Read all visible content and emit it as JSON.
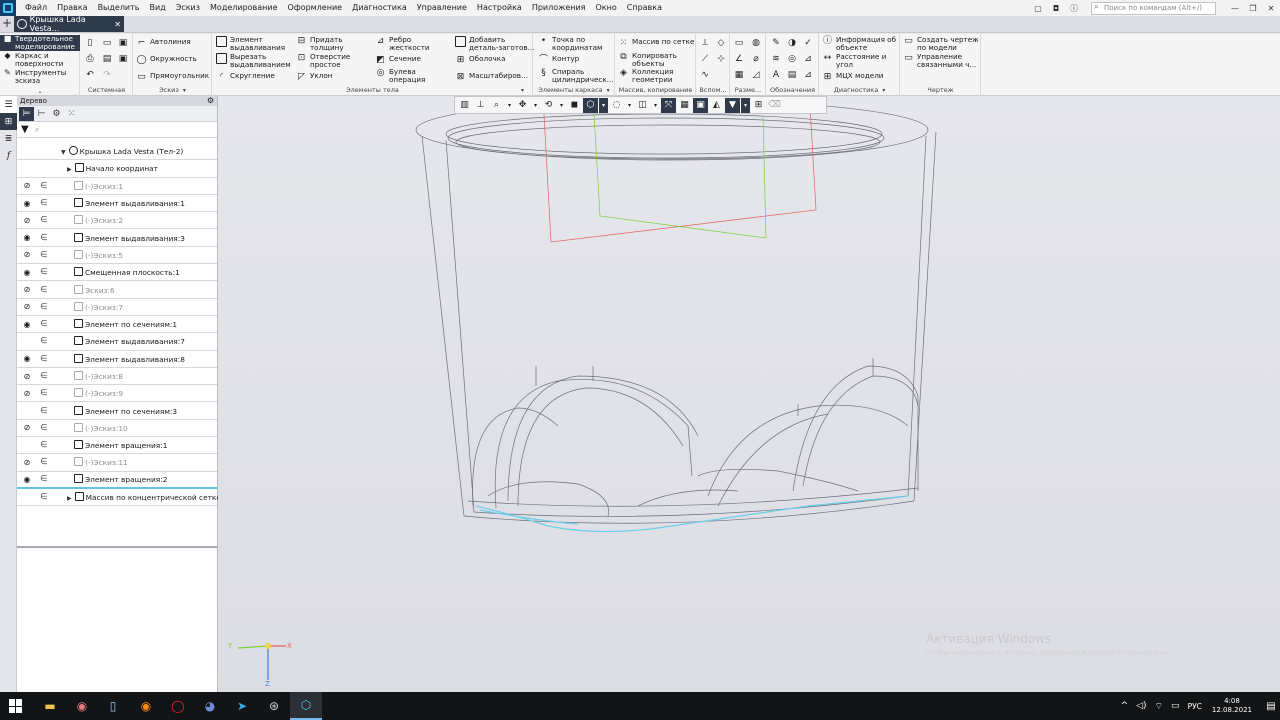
{
  "menu": {
    "items": [
      "Файл",
      "Правка",
      "Выделить",
      "Вид",
      "Эскиз",
      "Моделирование",
      "Оформление",
      "Диагностика",
      "Управление",
      "Настройка",
      "Приложения",
      "Окно",
      "Справка"
    ],
    "search_placeholder": "Поиск по командам (Alt+/)"
  },
  "tabs": {
    "add": "+",
    "document": "Крышка Lada Vesta..."
  },
  "ribbon": {
    "modes": [
      "Твердотельное моделирование",
      "Каркас и поверхности",
      "Инструменты эскиза"
    ],
    "groups": {
      "system": "Системная",
      "sketch": "Эскиз",
      "body": "Элементы тела",
      "frame": "Элементы каркаса",
      "pattern": "Массив, копирование",
      "aux": "Вспом...",
      "dims": "Разме...",
      "notes": "Обозначения",
      "diag": "Диагностика",
      "drawing": "Чертеж"
    },
    "sketch_buttons": [
      "Автолиния",
      "Окружность",
      "Прямоугольник"
    ],
    "body_buttons": {
      "extrude": "Элемент выдавливания",
      "cut_extrude": "Вырезать выдавливанием",
      "fillet": "Скругление",
      "thicken": "Придать толщину",
      "simple_hole": "Отверстие простое",
      "draft": "Уклон",
      "rib": "Ребро жесткости",
      "section": "Сечение",
      "boolean": "Булева операция",
      "add_part": "Добавить деталь-заготов...",
      "shell": "Оболочка",
      "scale": "Масштабиров..."
    },
    "frame_buttons": {
      "point": "Точка по координатам",
      "contour": "Контур",
      "helix": "Спираль цилиндрическ..."
    },
    "pattern_buttons": {
      "grid": "Массив по сетке",
      "copy": "Копировать объекты",
      "collection": "Коллекция геометрии"
    },
    "diag_buttons": {
      "info": "Информация об объекте",
      "distance": "Расстояние и угол",
      "mass": "МЦХ модели"
    },
    "drawing_buttons": {
      "create": "Создать чертеж по модели",
      "manage": "Управление связанными ч..."
    }
  },
  "tree": {
    "title": "Дерево",
    "root": "Крышка Lada Vesta (Тел-2)",
    "rows": [
      {
        "label": "Начало координат",
        "eye": "",
        "dim": false,
        "indent": 0
      },
      {
        "label": "(-)Эскиз:1",
        "eye": "hidden",
        "dim": true,
        "indent": 1
      },
      {
        "label": "Элемент выдавливания:1",
        "eye": "visible",
        "dim": false,
        "indent": 1
      },
      {
        "label": "(-)Эскиз:2",
        "eye": "hidden",
        "dim": true,
        "indent": 1
      },
      {
        "label": "Элемент выдавливания:3",
        "eye": "visible",
        "dim": false,
        "indent": 1
      },
      {
        "label": "(-)Эскиз:5",
        "eye": "hidden",
        "dim": true,
        "indent": 1
      },
      {
        "label": "Смещенная плоскость:1",
        "eye": "visible",
        "dim": false,
        "indent": 1
      },
      {
        "label": "Эскиз:6",
        "eye": "hidden",
        "dim": true,
        "indent": 1
      },
      {
        "label": "(-)Эскиз:7",
        "eye": "hidden",
        "dim": true,
        "indent": 1
      },
      {
        "label": "Элемент по сечениям:1",
        "eye": "visible",
        "dim": false,
        "indent": 1
      },
      {
        "label": "Элемент выдавливания:7",
        "eye": "",
        "dim": false,
        "indent": 1
      },
      {
        "label": "Элемент выдавливания:8",
        "eye": "visible",
        "dim": false,
        "indent": 1
      },
      {
        "label": "(-)Эскиз:8",
        "eye": "hidden",
        "dim": true,
        "indent": 1
      },
      {
        "label": "(-)Эскиз:9",
        "eye": "hidden",
        "dim": true,
        "indent": 1
      },
      {
        "label": "Элемент по сечениям:3",
        "eye": "",
        "dim": false,
        "indent": 1
      },
      {
        "label": "(-)Эскиз:10",
        "eye": "hidden",
        "dim": true,
        "indent": 1
      },
      {
        "label": "Элемент вращения:1",
        "eye": "",
        "dim": false,
        "indent": 1
      },
      {
        "label": "(-)Эскиз:11",
        "eye": "hidden",
        "dim": true,
        "indent": 1
      },
      {
        "label": "Элемент вращения:2",
        "eye": "visible",
        "dim": false,
        "indent": 1
      },
      {
        "label": "Массив по концентрической сетке",
        "eye": "",
        "dim": false,
        "indent": 0
      }
    ]
  },
  "axes": {
    "x": "X",
    "y": "Y",
    "z": "Z"
  },
  "watermark": {
    "title": "Активация Windows",
    "subtitle": "Чтобы активировать Windows, перейдите в раздел «Параметры»."
  },
  "taskbar": {
    "lang": "РУС",
    "time": "4:08",
    "date": "12.08.2021"
  },
  "colors": {
    "accent": "#2f3a4a",
    "selection": "#5cc6e4",
    "axis_red": "#e26060",
    "axis_green": "#7ccf3a"
  }
}
